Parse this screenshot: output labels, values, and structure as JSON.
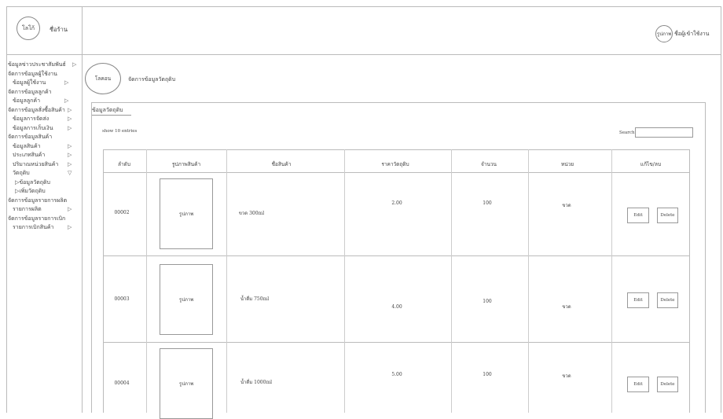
{
  "header": {
    "logo_text": "โลโก้",
    "shop_name": "ชื่อร้าน",
    "user_avatar_text": "รูปภาพ",
    "user_name": "ชื่อผู้เข้าใช้งาน"
  },
  "sidebar": {
    "items": [
      {
        "label": "ข้อมูลข่าวประชาสัมพันธ์",
        "arrow": "▷"
      },
      {
        "label": "จัดการข้อมูลผู้ใช้งาน",
        "arrow": ""
      },
      {
        "label": "ข้อมูลผู้ใช้งาน",
        "arrow": "▷"
      },
      {
        "label": "จัดการข้อมูลลูกค้า",
        "arrow": ""
      },
      {
        "label": "ข้อมูลลูกค้า",
        "arrow": "▷"
      },
      {
        "label": "จัดการข้อมูลสั่งซื้อสินค้า",
        "arrow": "▷"
      },
      {
        "label": "ข้อมูลการจัดส่ง",
        "arrow": "▷"
      },
      {
        "label": "ข้อมูลการเก็บเงิน",
        "arrow": "▷"
      },
      {
        "label": "จัดการข้อมูลสินค้า",
        "arrow": ""
      },
      {
        "label": "ข้อมูลสินค้า",
        "arrow": "▷"
      },
      {
        "label": "ประเภทสินค้า",
        "arrow": "▷"
      },
      {
        "label": "ปริมาณหน่วยสินค้า",
        "arrow": "▷"
      },
      {
        "label": "วัตถุดิบ",
        "arrow": "▽"
      },
      {
        "label": "▷ข้อมูลวัตถุดิบ",
        "arrow": ""
      },
      {
        "label": "▷เพิ่มวัตถุดิบ",
        "arrow": ""
      },
      {
        "label": "จัดการข้อมูลรายการผลิต",
        "arrow": ""
      },
      {
        "label": "รายการผลิต",
        "arrow": "▷"
      },
      {
        "label": "จัดการข้อมูลรายการเบิก",
        "arrow": ""
      },
      {
        "label": "รายการเบิกสินค้า",
        "arrow": "▷"
      }
    ]
  },
  "content": {
    "circle_text": "โลคอน",
    "title": "จัดการข้อมูลวัตถุดิบ",
    "panel_title": "ข้อมูลวัตถุดิบ",
    "show_entries": "show 10 entries",
    "search_label": "Search:",
    "search_value": ""
  },
  "table": {
    "headers": [
      "ลำดับ",
      "รูปภาพสินค้า",
      "ชื่อสินค้า",
      "ราคาวัตถุดิบ",
      "จำนวน",
      "หน่วย",
      "แก้ไข/ลบ"
    ],
    "rows": [
      {
        "id": "00002",
        "image": "รูปภาพ",
        "name": "ขวด 300ml",
        "price": "2.00",
        "qty": "100",
        "unit": "ขวด",
        "edit": "Edit",
        "delete": "Delete"
      },
      {
        "id": "00003",
        "image": "รูปภาพ",
        "name": "น้ำดื่ม 750ml",
        "price": "4.00",
        "qty": "100",
        "unit": "ขวด",
        "edit": "Edit",
        "delete": "Delete"
      },
      {
        "id": "00004",
        "image": "รูปภาพ",
        "name": "น้ำดื่ม 1000ml",
        "price": "5.00",
        "qty": "100",
        "unit": "ขวด",
        "edit": "Edit",
        "delete": "Delete"
      }
    ]
  }
}
